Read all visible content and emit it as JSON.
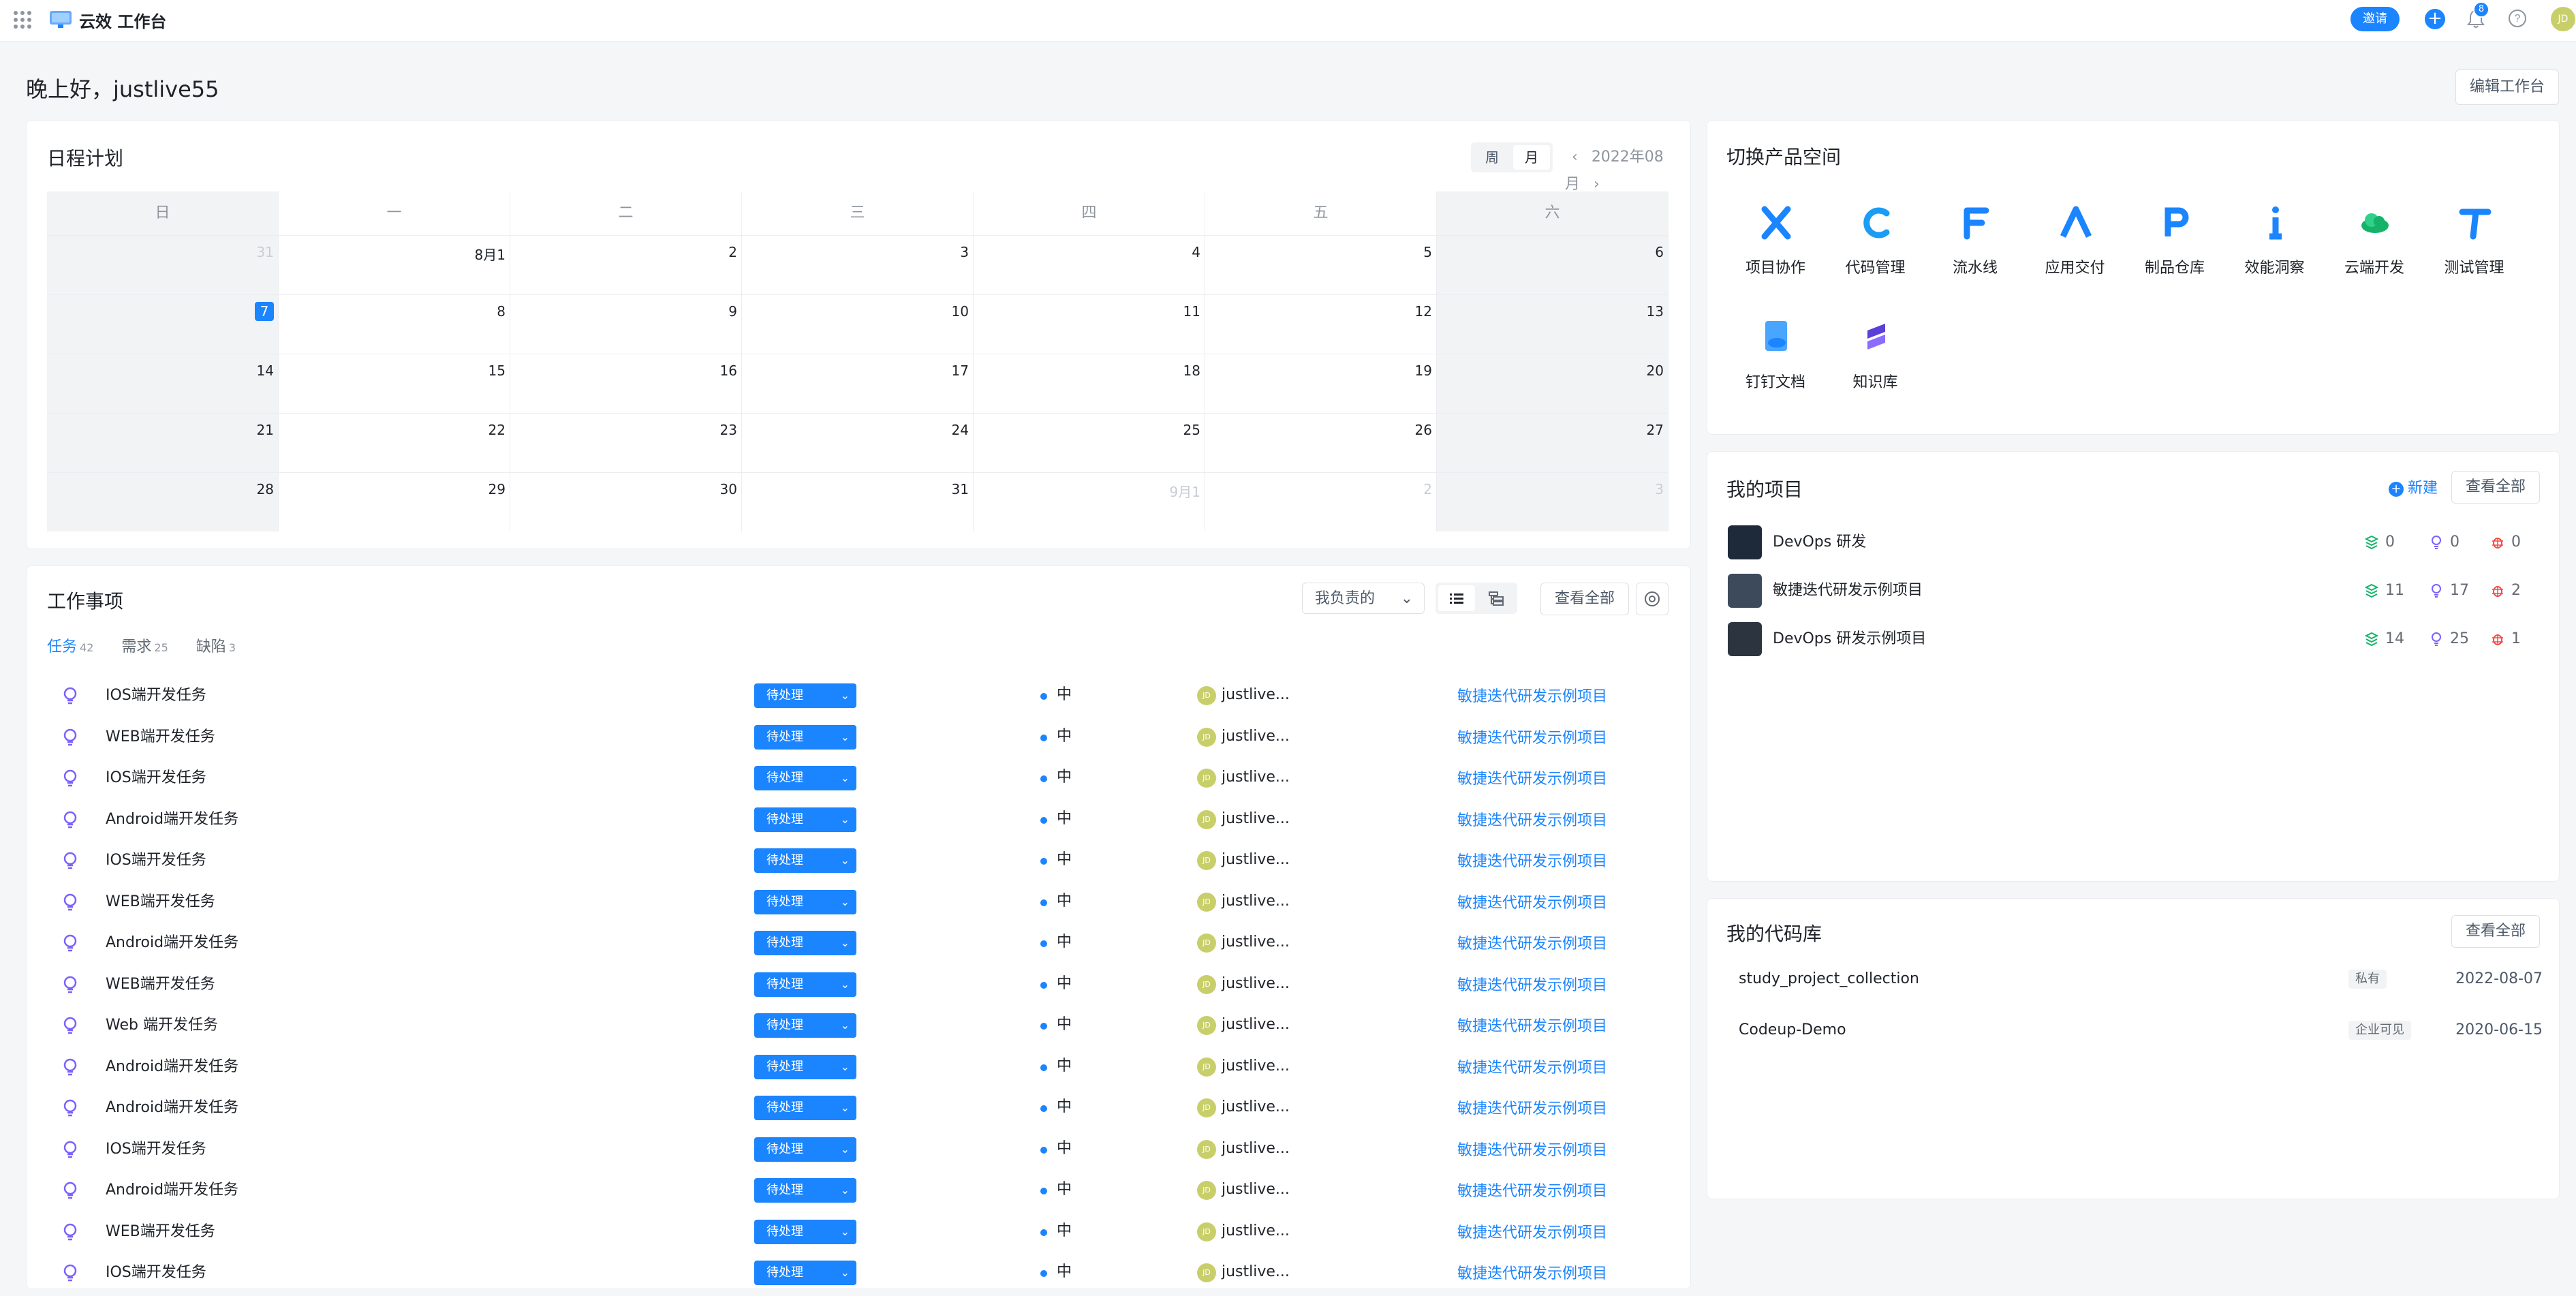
{
  "topbar": {
    "brand": "云效 工作台",
    "invite_label": "邀请",
    "notification_count": "8",
    "avatar_initials": "JD"
  },
  "greeting": "晚上好，justlive55",
  "edit_workspace_label": "编辑工作台",
  "calendar": {
    "title": "日程计划",
    "view_week": "周",
    "view_month": "月",
    "month_label": "2022年08月",
    "weekdays": [
      "日",
      "一",
      "二",
      "三",
      "四",
      "五",
      "六"
    ],
    "weeks": [
      [
        "31",
        "8月1",
        "2",
        "3",
        "4",
        "5",
        "6"
      ],
      [
        "7",
        "8",
        "9",
        "10",
        "11",
        "12",
        "13"
      ],
      [
        "14",
        "15",
        "16",
        "17",
        "18",
        "19",
        "20"
      ],
      [
        "21",
        "22",
        "23",
        "24",
        "25",
        "26",
        "27"
      ],
      [
        "28",
        "29",
        "30",
        "31",
        "9月1",
        "2",
        "3"
      ]
    ]
  },
  "work": {
    "title": "工作事项",
    "filter_label": "我负责的",
    "view_all_label": "查看全部",
    "tabs": [
      {
        "label": "任务",
        "count": "42"
      },
      {
        "label": "需求",
        "count": "25"
      },
      {
        "label": "缺陷",
        "count": "3"
      }
    ],
    "status_label": "待处理",
    "priority_label": "中",
    "assignee": "justlive...",
    "assignee_initials": "JD",
    "project": "敏捷迭代研发示例项目",
    "rows": [
      "IOS端开发任务",
      "WEB端开发任务",
      "IOS端开发任务",
      "Android端开发任务",
      "IOS端开发任务",
      "WEB端开发任务",
      "Android端开发任务",
      "WEB端开发任务",
      "Web 端开发任务",
      "Android端开发任务",
      "Android端开发任务",
      "IOS端开发任务",
      "Android端开发任务",
      "WEB端开发任务",
      "IOS端开发任务"
    ]
  },
  "products": {
    "title": "切换产品空间",
    "items": [
      {
        "label": "项目协作",
        "icon": "project-collab-icon",
        "color": "#1b84ff"
      },
      {
        "label": "代码管理",
        "icon": "code-mgmt-icon",
        "color": "#1b9cf5"
      },
      {
        "label": "流水线",
        "icon": "pipeline-icon",
        "color": "#1b84ff"
      },
      {
        "label": "应用交付",
        "icon": "app-delivery-icon",
        "color": "#1b84ff"
      },
      {
        "label": "制品仓库",
        "icon": "artifact-repo-icon",
        "color": "#1b84ff"
      },
      {
        "label": "效能洞察",
        "icon": "insight-icon",
        "color": "#1b84ff"
      },
      {
        "label": "云端开发",
        "icon": "cloud-dev-icon",
        "color": "#17b26a"
      },
      {
        "label": "测试管理",
        "icon": "test-mgmt-icon",
        "color": "#1b84ff"
      },
      {
        "label": "钉钉文档",
        "icon": "dingtalk-doc-icon",
        "color": "#1b84ff"
      },
      {
        "label": "知识库",
        "icon": "knowledge-base-icon",
        "color": "#5b3fd8"
      }
    ]
  },
  "projects": {
    "title": "我的项目",
    "new_label": "新建",
    "view_all_label": "查看全部",
    "items": [
      {
        "name": "DevOps 研发",
        "reqs": "0",
        "tasks": "0",
        "bugs": "0",
        "thumb": "#1e2a3a"
      },
      {
        "name": "敏捷迭代研发示例项目",
        "reqs": "11",
        "tasks": "17",
        "bugs": "2",
        "thumb": "#3d4a5c"
      },
      {
        "name": "DevOps 研发示例项目",
        "reqs": "14",
        "tasks": "25",
        "bugs": "1",
        "thumb": "#2c3440"
      }
    ]
  },
  "repos": {
    "title": "我的代码库",
    "view_all_label": "查看全部",
    "items": [
      {
        "name": "study_project_collection",
        "visibility": "私有",
        "date": "2022-08-07"
      },
      {
        "name": "Codeup-Demo",
        "visibility": "企业可见",
        "date": "2020-06-15"
      }
    ]
  }
}
